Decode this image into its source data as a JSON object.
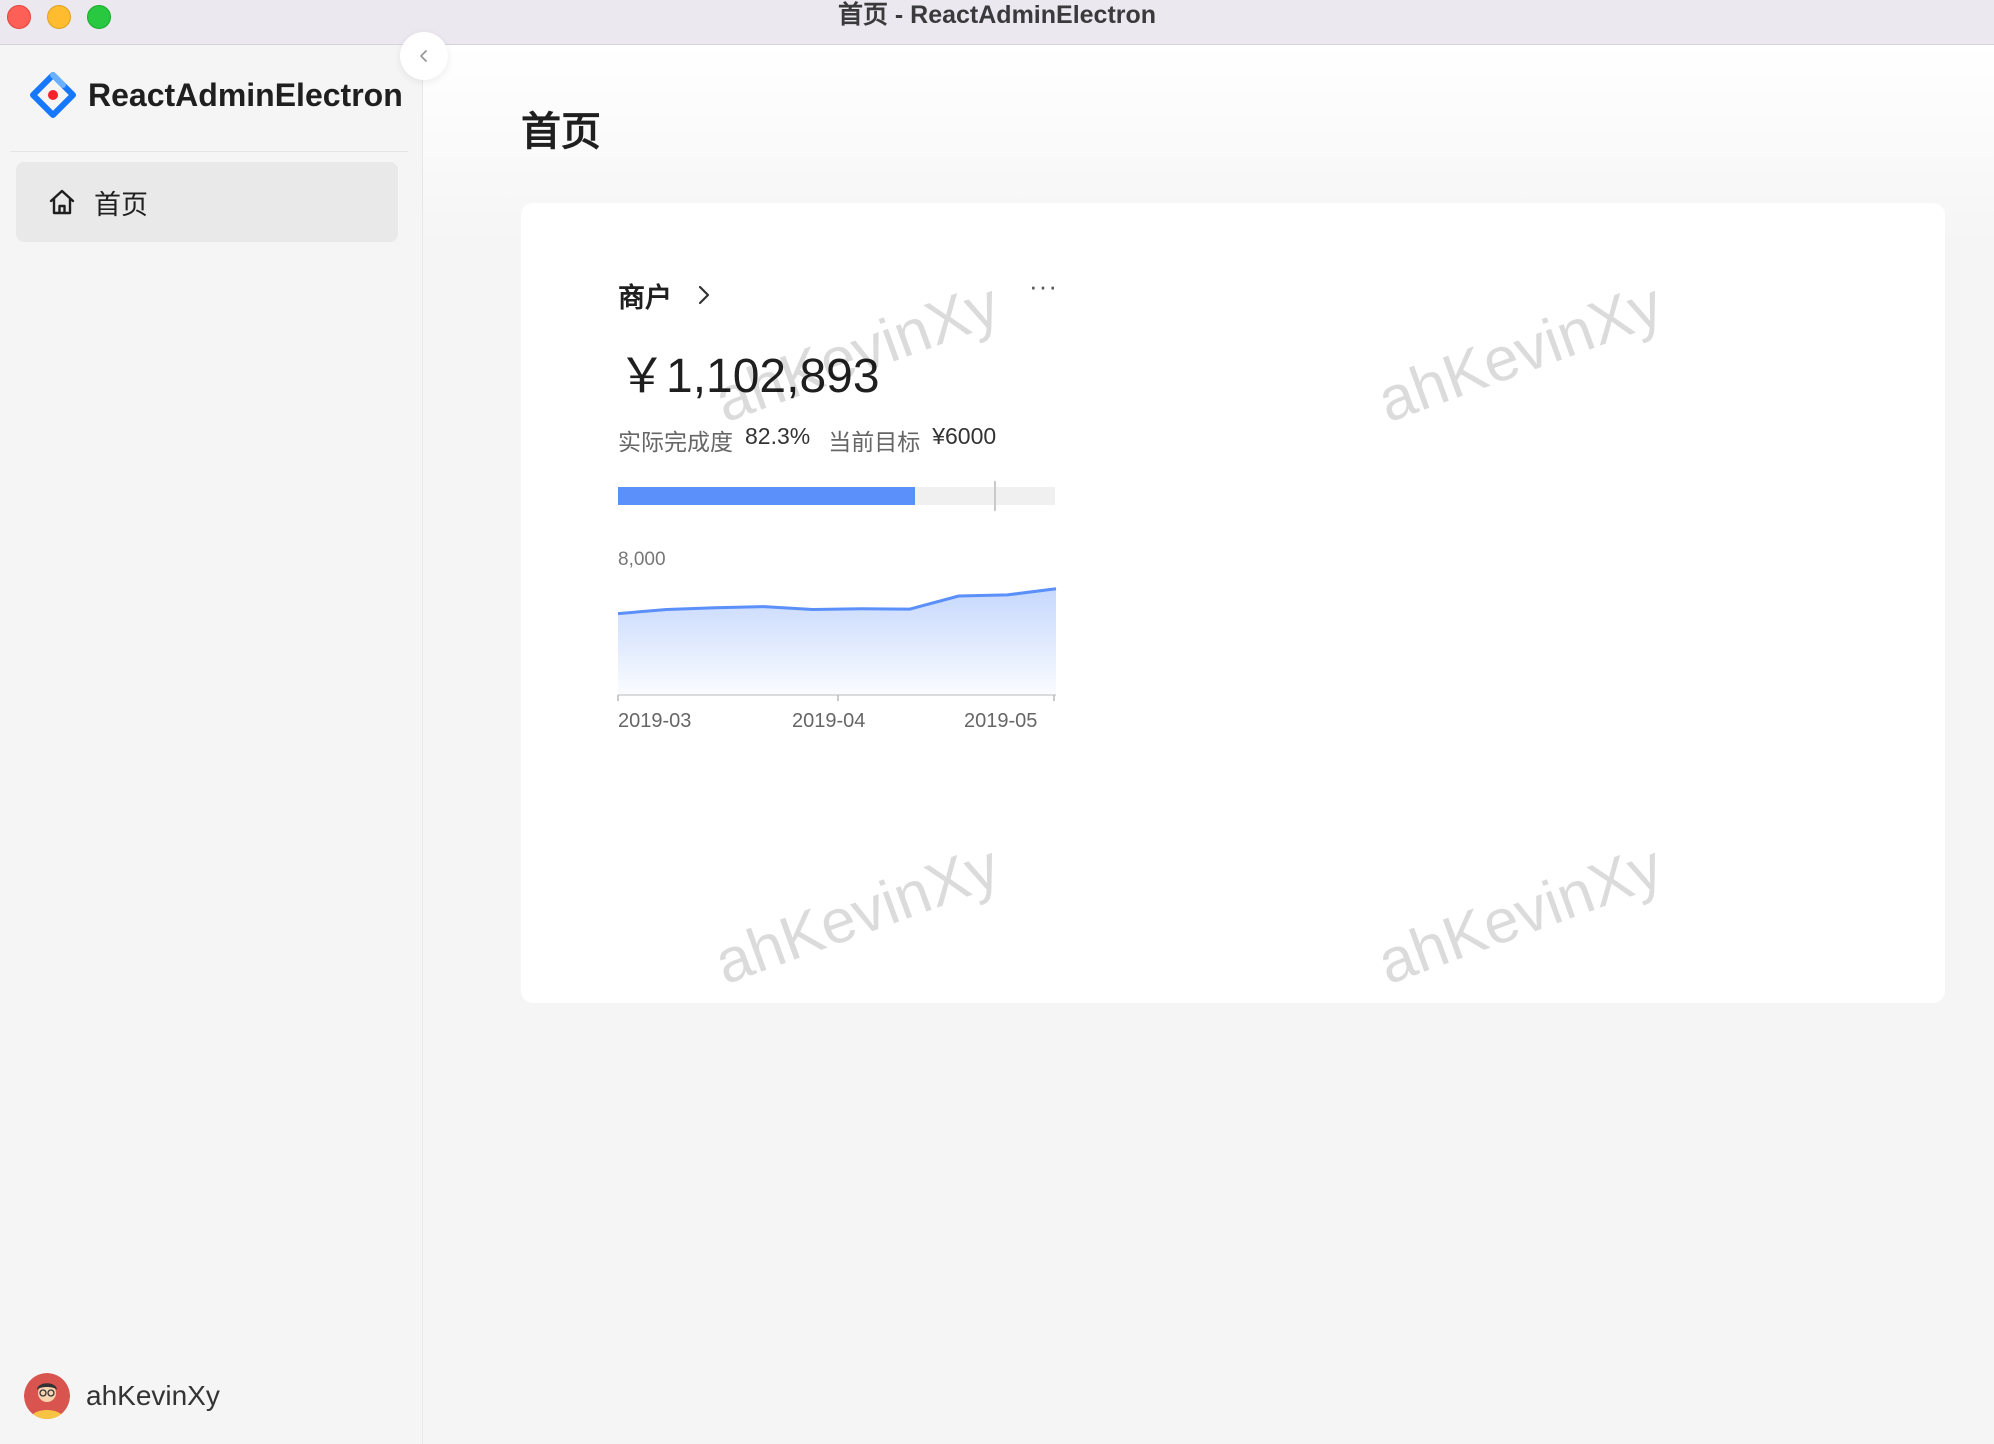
{
  "window": {
    "title": "首页 - ReactAdminElectron"
  },
  "sidebar": {
    "brand": "ReactAdminElectron",
    "menu": [
      {
        "label": "首页",
        "icon": "home-icon",
        "selected": true
      }
    ],
    "user": {
      "name": "ahKevinXy"
    }
  },
  "main": {
    "page_title": "首页",
    "card": {
      "title": "商户",
      "amount": "￥1,102,893",
      "completion_label": "实际完成度",
      "completion_value": "82.3%",
      "target_label": "当前目标",
      "target_value": "¥6000"
    }
  },
  "watermark": "ahKevinXy",
  "colors": {
    "accent": "#5b8ff9",
    "logo_blue": "#1677ff",
    "logo_red": "#f5222d"
  },
  "progress": {
    "filled_percent": 68,
    "target_percent": 86
  },
  "chart_data": {
    "type": "area",
    "y_tick_label": "8,000",
    "x_tick_labels": [
      "2019-03",
      "2019-04",
      "2019-05"
    ],
    "values": [
      5900,
      6200,
      6320,
      6410,
      6200,
      6250,
      6230,
      7180,
      7260,
      7700
    ],
    "ylim": [
      0,
      8700
    ],
    "grid": false
  }
}
